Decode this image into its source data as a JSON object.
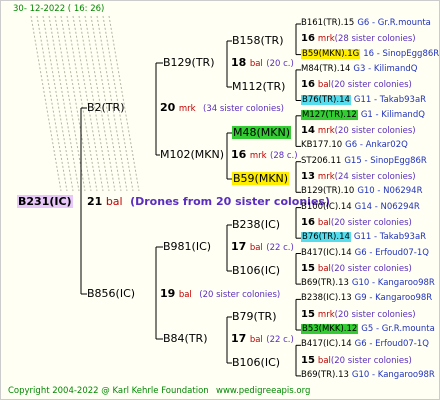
{
  "date": "30- 12-2022 ( 16: 26)",
  "root": {
    "id": "B231(IC)",
    "colonies": "21",
    "mark": "bal",
    "note": "(Drones from 20 sister colonies)",
    "bg": "#e8c8f8"
  },
  "gen1": [
    {
      "id": "B2(TR)"
    },
    {
      "id": "B856(IC)"
    }
  ],
  "gen1_colonies": [
    {
      "n": "20",
      "m": "mrk",
      "note": "(34 sister colonies)"
    },
    {
      "n": "19",
      "m": "bal",
      "note": "(20 sister colonies)"
    }
  ],
  "gen2": [
    {
      "id": "B129(TR)"
    },
    {
      "id": "M102(MKN)"
    },
    {
      "id": "B981(IC)"
    },
    {
      "id": "B84(TR)"
    }
  ],
  "gen2_colonies": [
    {
      "n": "18",
      "m": "bal",
      "note": "(20 c.)"
    },
    {
      "n": "16",
      "m": "mrk",
      "note": "(28 c.)"
    },
    {
      "n": "17",
      "m": "bal",
      "note": "(22 c.)"
    },
    {
      "n": "17",
      "m": "bal",
      "note": "(22 c.)"
    }
  ],
  "gen3": [
    {
      "id": "B158(TR)"
    },
    {
      "id": "M112(TR)"
    },
    {
      "id": "M48(MKN)",
      "bg": "#33cc33"
    },
    {
      "id": "B59(MKN)",
      "bg": "#ffee00"
    },
    {
      "id": "B238(IC)"
    },
    {
      "id": "B106(IC)"
    },
    {
      "id": "B79(TR)"
    },
    {
      "id": "B106(IC)"
    }
  ],
  "gen4_rows": [
    {
      "id": "B161(TR).15",
      "link": "G6 - Gr.R.mounta"
    },
    {
      "num": "16",
      "m": "mrk",
      "note": "(28 sister colonies)"
    },
    {
      "id": "B59(MKN).1G",
      "bg": "#ffee00",
      "link": "16 - SinopEgg86R"
    },
    {
      "id": "M84(TR).14",
      "link": "G3 - KilimandQ"
    },
    {
      "num": "16",
      "m": "bal",
      "note": "(20 sister colonies)"
    },
    {
      "id": "B76(TR).14",
      "bg": "#55ddee",
      "link": "G11 - Takab93aR"
    },
    {
      "id": "M127(TR).12",
      "bg": "#33cc33",
      "link": "G1 - KilimandQ"
    },
    {
      "num": "14",
      "m": "mrk",
      "note": "(20 sister colonies)"
    },
    {
      "id": "KB177.10",
      "link": "G6 - Ankar02Q"
    },
    {
      "id": "ST206.11",
      "link": "G15 - SinopEgg86R"
    },
    {
      "num": "13",
      "m": "mrk",
      "note": "(24 sister colonies)"
    },
    {
      "id": "B129(TR).10",
      "link": "G10 - N06294R"
    },
    {
      "id": "B100(IC).14",
      "link": "G14 - N06294R"
    },
    {
      "num": "16",
      "m": "bal",
      "note": "(20 sister colonies)"
    },
    {
      "id": "B76(TR).14",
      "bg": "#55ddee",
      "link": "G11 - Takab93aR"
    },
    {
      "id": "B417(IC).14",
      "link": "G6 - Erfoud07-1Q"
    },
    {
      "num": "15",
      "m": "bal",
      "note": "(20 sister colonies)"
    },
    {
      "id": "B69(TR).13",
      "link": "G10 - Kangaroo98R"
    },
    {
      "id": "B238(IC).13",
      "link": "G9 - Kangaroo98R"
    },
    {
      "num": "15",
      "m": "mrk",
      "note": "(20 sister colonies)"
    },
    {
      "id": "B53(MKK).12",
      "bg": "#33cc33",
      "link": "G5 - Gr.R.mounta"
    },
    {
      "id": "B417(IC).14",
      "link": "G6 - Erfoud07-1Q"
    },
    {
      "num": "15",
      "m": "bal",
      "note": "(20 sister colonies)"
    },
    {
      "id": "B69(TR).13",
      "link": "G10 - Kangaroo98R"
    }
  ],
  "footer": {
    "copyright": "Copyright 2004-2022 @ Karl Kehrle Foundation",
    "site": "www.pedigreeapis.org"
  },
  "colors": {
    "footer": "#008800",
    "link": "#2233bb",
    "mark": "#c00000",
    "sister": "#5a2dbf"
  }
}
